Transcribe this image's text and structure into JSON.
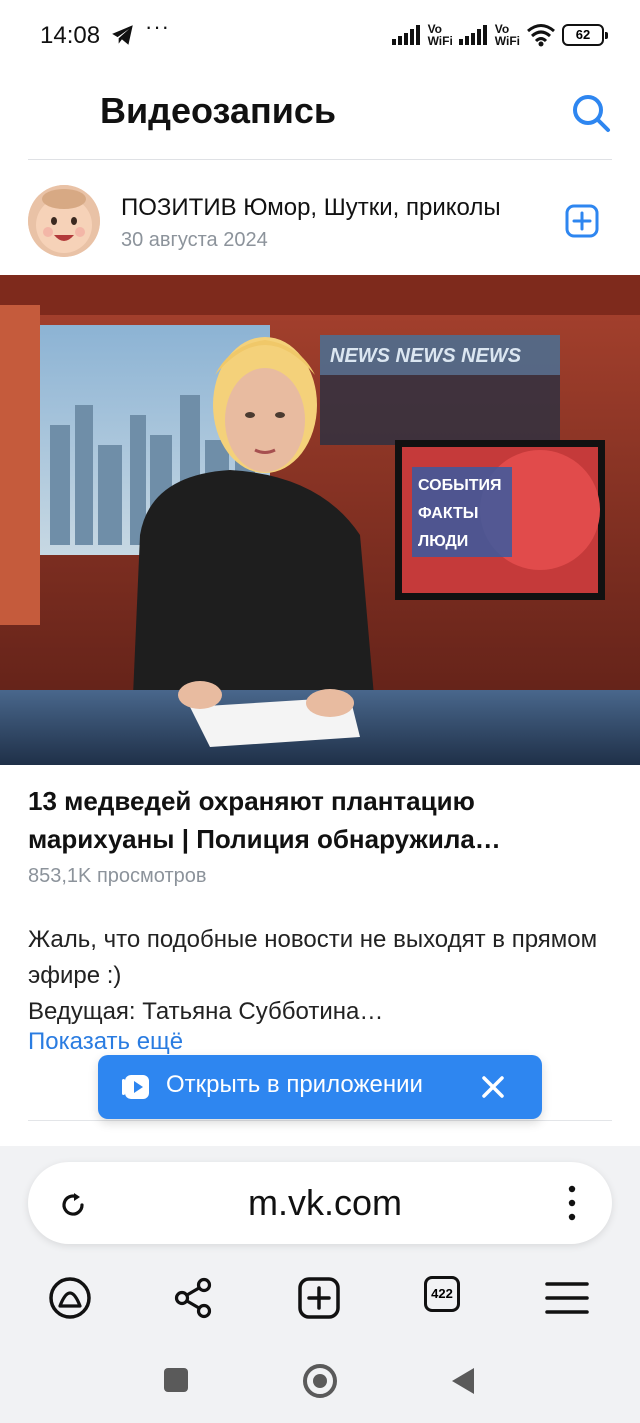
{
  "status_bar": {
    "time": "14:08",
    "dots": "···",
    "vowifi_1_line1": "Vo",
    "vowifi_1_line2": "WiFi",
    "vowifi_2_line1": "Vo",
    "vowifi_2_line2": "WiFi",
    "battery": "62"
  },
  "header": {
    "title": "Видеозапись",
    "search_icon": "search-icon"
  },
  "author": {
    "name": "ПОЗИТИВ Юмор, Шутки, приколы",
    "date": "30 августа 2024",
    "subscribe_icon": "plus-square-icon"
  },
  "video": {
    "screen_text": "СОБЫТИЯ ФАКТЫ ЛЮДИ",
    "banner_text": "NEWS NEWS NEWS",
    "title": "13 медведей охраняют плантацию марихуаны | Полиция обнаружила…",
    "views": "853,1K просмотров",
    "description_line1": "Жаль, что подобные новости не выходят в прямом эфире :)",
    "description_line2": "Ведущая: Татьяна Субботина…",
    "show_more": "Показать ещё"
  },
  "open_app": {
    "label": "Открыть в приложении"
  },
  "browser": {
    "url": "m.vk.com",
    "tab_count": "422"
  },
  "colors": {
    "accent": "#2e86f0",
    "link": "#2a7ce1",
    "muted": "#8c939b"
  }
}
